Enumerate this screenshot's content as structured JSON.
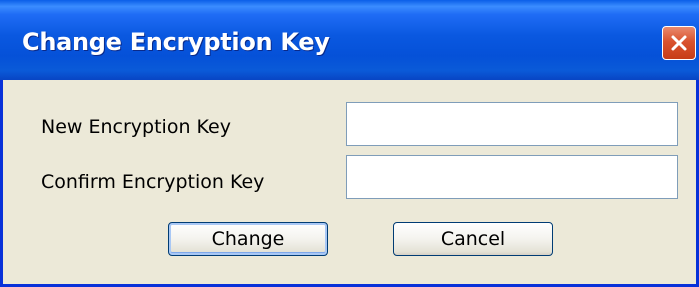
{
  "window": {
    "title": "Change Encryption Key",
    "close_icon": "close-icon"
  },
  "form": {
    "new_key_label": "New Encryption Key",
    "new_key_value": "",
    "confirm_key_label": "Confirm Encryption Key",
    "confirm_key_value": ""
  },
  "buttons": {
    "change_label": "Change",
    "cancel_label": "Cancel"
  },
  "colors": {
    "titlebar": "#0a58e0",
    "window_border": "#0831d9",
    "window_background": "#ece9d8",
    "close_button": "#d9532f"
  }
}
